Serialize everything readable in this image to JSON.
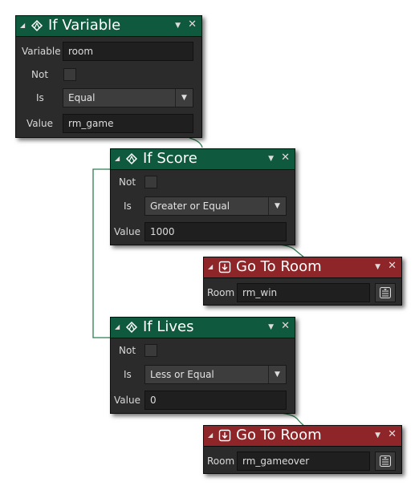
{
  "if_variable": {
    "title": "If Variable",
    "variable_label": "Variable",
    "variable_value": "room",
    "not_label": "Not",
    "is_label": "Is",
    "is_value": "Equal",
    "value_label": "Value",
    "value_value": "rm_game"
  },
  "if_score": {
    "title": "If Score",
    "not_label": "Not",
    "is_label": "Is",
    "is_value": "Greater or Equal",
    "value_label": "Value",
    "value_value": "1000"
  },
  "goto_room_1": {
    "title": "Go To Room",
    "room_label": "Room",
    "room_value": "rm_win"
  },
  "if_lives": {
    "title": "If Lives",
    "not_label": "Not",
    "is_label": "Is",
    "is_value": "Less or Equal",
    "value_label": "Value",
    "value_value": "0"
  },
  "goto_room_2": {
    "title": "Go To Room",
    "room_label": "Room",
    "room_value": "rm_gameover"
  },
  "colors": {
    "conditional_header": "#0f5a3e",
    "action_header": "#8e2528",
    "body": "#2b2b2b",
    "connector": "#2e7d4f"
  },
  "icons": [
    "collapse-triangle-icon",
    "conditional-icon",
    "go-to-room-icon",
    "dropdown-arrow-icon",
    "close-icon",
    "room-picker-icon"
  ]
}
